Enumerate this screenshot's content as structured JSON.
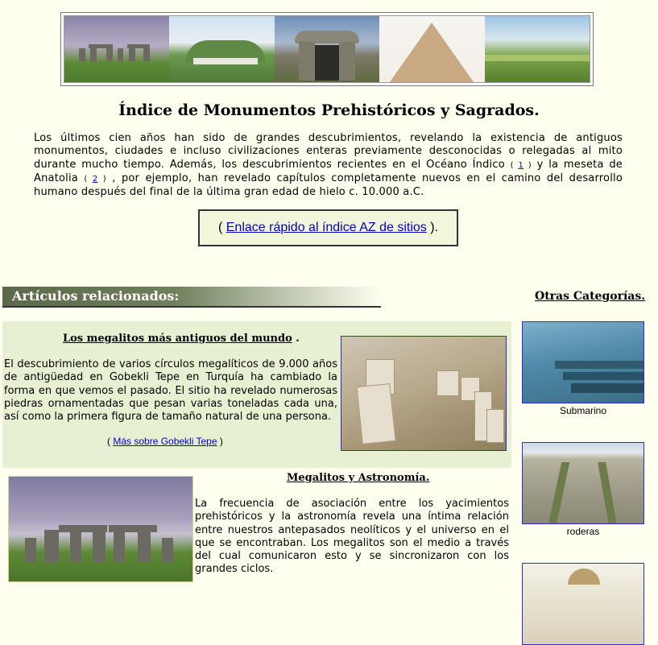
{
  "banner": {
    "images": [
      {
        "icon": "stonehenge-image"
      },
      {
        "icon": "newgrange-mound-image"
      },
      {
        "icon": "dolmen-image"
      },
      {
        "icon": "pyramid-image"
      },
      {
        "icon": "earthwork-image"
      }
    ]
  },
  "page_title": "Índice de Monumentos Prehistóricos y Sagrados.",
  "intro": {
    "text_before_ref1": "Los últimos cien años han sido de grandes descubrimientos, revelando la existencia de antiguos monumentos, ciudades e incluso civilizaciones enteras previamente desconocidas o relegadas al mito durante mucho tiempo. Además, los descubrimientos recientes en el Océano Índico",
    "ref1_open": "(",
    "ref1_label": "1",
    "ref1_close": ")",
    "text_between": "y la meseta de Anatolia",
    "ref2_open": "(",
    "ref2_label": "2",
    "ref2_close": ")",
    "text_after_ref2": ", por ejemplo, han revelado capítulos completamente nuevos en el camino del desarrollo humano después del final de la última gran edad de hielo c. 10.000 a.C."
  },
  "quick_link": {
    "open": "(",
    "label": "Enlace rápido al índice AZ de sitios",
    "close": ")."
  },
  "related": {
    "heading": "Artículos relacionados:"
  },
  "sidebar": {
    "heading": "Otras Categorías.",
    "items": [
      {
        "caption": "Submarino"
      },
      {
        "caption": "roderas"
      },
      {
        "caption": ""
      }
    ]
  },
  "article1": {
    "title": "Los megalitos más antiguos del mundo",
    "title_suffix": ".",
    "text": "El descubrimiento de varios círculos megalíticos de 9.000 años de antigüedad en Gobekli Tepe en Turquía ha cambiado la forma en que vemos el pasado. El sitio ha revelado numerosas piedras ornamentadas que pesan varias toneladas cada una, así como la primera figura de tamaño natural de una persona.",
    "more_open": "(",
    "more_label": "Más sobre Gobekli Tepe",
    "more_close": ")"
  },
  "article2": {
    "title": "Megalitos y Astronomía.",
    "text": "La frecuencia de asociación entre los yacimientos prehistóricos y la astronomía revela una íntima relación entre nuestros antepasados neolíticos y el universo en el que se encontraban. Los megalitos son el medio a través del cual comunicaron esto y se sincronizaron con los grandes ciclos."
  },
  "colors": {
    "page_bg": "#fffff0",
    "link": "#0000cc",
    "card_bg": "#e8f0d2",
    "related_bar": "#5a6a4a"
  }
}
